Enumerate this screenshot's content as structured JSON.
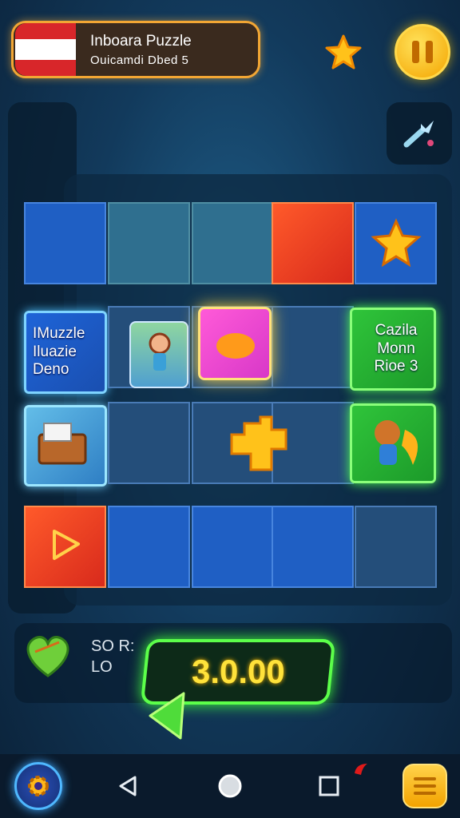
{
  "header": {
    "title_line1": "Inboara Puzzle",
    "title_line2": "Ouicamdi Dbed  5"
  },
  "board": {
    "left_card": [
      "IMuzzle",
      "Iluazie",
      "Deno"
    ],
    "right_card": [
      "Cazila",
      "Monn",
      "Rioe 3"
    ]
  },
  "score": {
    "label_line1": "SO R:",
    "label_line2": "LO",
    "value": "3.0.00"
  },
  "icons": {
    "star": "star-icon",
    "pause": "pause-icon",
    "tool": "magic-wand-icon",
    "heart": "heart-icon",
    "settings": "gear-icon",
    "back": "triangle-back-icon",
    "home": "circle-home-icon",
    "recent": "square-recent-icon",
    "menu": "hamburger-menu-icon"
  },
  "colors": {
    "accent_orange": "#f2a634",
    "accent_green": "#5cff4a",
    "accent_yellow": "#ffe23a",
    "tile_blue": "#1f5fc4",
    "tile_red": "#d82a1c"
  }
}
